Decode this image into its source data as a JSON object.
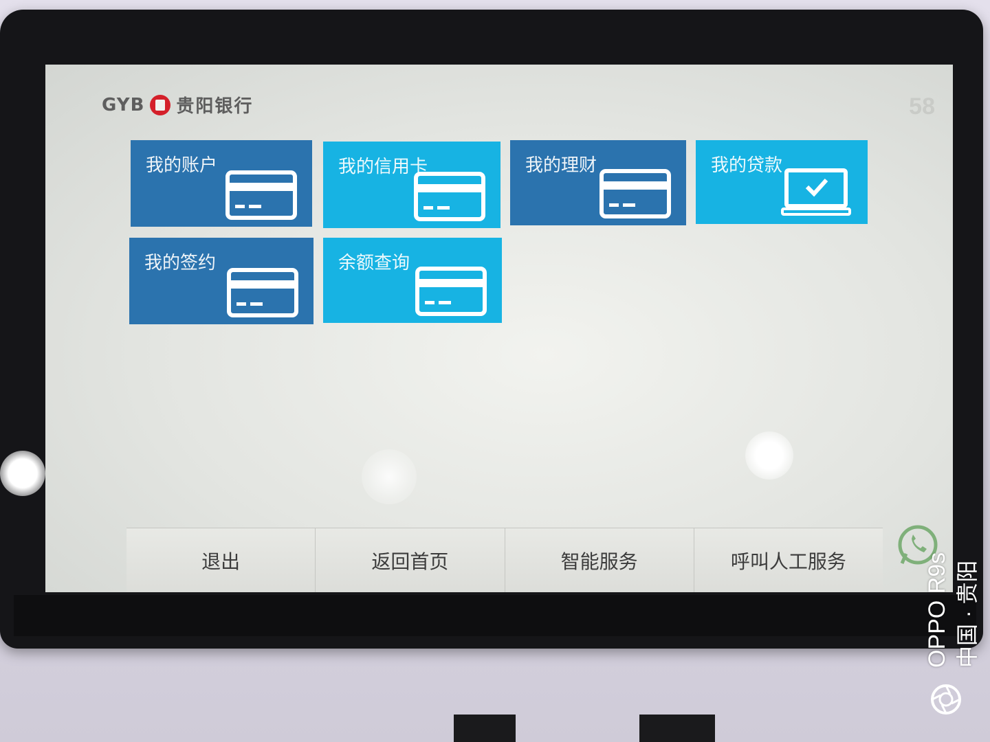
{
  "header": {
    "logo_abbr": "GYB",
    "logo_name": "贵阳银行",
    "countdown": "58"
  },
  "tiles": [
    {
      "label": "我的账户",
      "icon": "bank-card-icon",
      "color": "#2b73ae"
    },
    {
      "label": "我的信用卡",
      "icon": "bank-card-icon",
      "color": "#17b3e3"
    },
    {
      "label": "我的理财",
      "icon": "bank-card-icon",
      "color": "#2b73ae"
    },
    {
      "label": "我的贷款",
      "icon": "laptop-check-icon",
      "color": "#17b3e3"
    },
    {
      "label": "我的签约",
      "icon": "bank-card-icon",
      "color": "#2b73ae"
    },
    {
      "label": "余额查询",
      "icon": "bank-card-icon",
      "color": "#17b3e3"
    }
  ],
  "bottom_bar": {
    "exit": "退出",
    "home": "返回首页",
    "smart_service": "智能服务",
    "call_staff": "呼叫人工服务"
  },
  "watermark": {
    "device": "OPPO R9s",
    "location": "中国 · 贵阳"
  }
}
